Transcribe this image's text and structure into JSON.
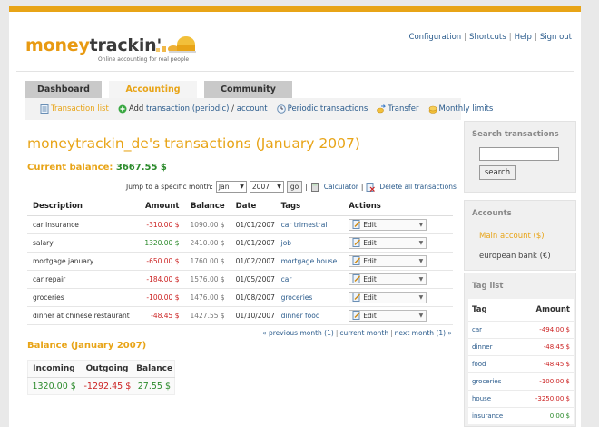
{
  "app": {
    "logo_part1": "money",
    "logo_part2": "trackin'",
    "tagline": "Online accounting for real people"
  },
  "toplinks": [
    "Configuration",
    "Shortcuts",
    "Help",
    "Sign out"
  ],
  "tabs": [
    {
      "label": "Dashboard",
      "active": false
    },
    {
      "label": "Accounting",
      "active": true
    },
    {
      "label": "Community",
      "active": false
    }
  ],
  "subnav": {
    "transaction_list": "Transaction list",
    "add": "Add",
    "add_transaction": "transaction",
    "add_periodic": "(periodic)",
    "add_slash": "/",
    "add_account": "account",
    "periodic": "Periodic transactions",
    "transfer": "Transfer",
    "monthly_limits": "Monthly limits"
  },
  "main": {
    "title": "moneytrackin_de's transactions  (January 2007)",
    "current_balance_label": "Current balance:",
    "current_balance_value": "3667.55 $",
    "jump_label": "Jump to a specific month:",
    "month_selected": "Jan",
    "year_selected": "2007",
    "go_label": "go",
    "calculator": "Calculator",
    "delete_all": "Delete all transactions"
  },
  "table": {
    "headers": [
      "Description",
      "Amount",
      "Balance",
      "Date",
      "Tags",
      "Actions"
    ],
    "rows": [
      {
        "description": "car insurance",
        "amount": "-310.00 $",
        "balance": "1090.00 $",
        "date": "01/01/2007",
        "tags": "car trimestral",
        "action": "Edit",
        "sign": "neg"
      },
      {
        "description": "salary",
        "amount": "1320.00 $",
        "balance": "2410.00 $",
        "date": "01/01/2007",
        "tags": "job",
        "action": "Edit",
        "sign": "pos"
      },
      {
        "description": "mortgage january",
        "amount": "-650.00 $",
        "balance": "1760.00 $",
        "date": "01/02/2007",
        "tags": "mortgage house",
        "action": "Edit",
        "sign": "neg"
      },
      {
        "description": "car repair",
        "amount": "-184.00 $",
        "balance": "1576.00 $",
        "date": "01/05/2007",
        "tags": "car",
        "action": "Edit",
        "sign": "neg"
      },
      {
        "description": "groceries",
        "amount": "-100.00 $",
        "balance": "1476.00 $",
        "date": "01/08/2007",
        "tags": "groceries",
        "action": "Edit",
        "sign": "neg"
      },
      {
        "description": "dinner at chinese restaurant",
        "amount": "-48.45 $",
        "balance": "1427.55 $",
        "date": "01/10/2007",
        "tags": "dinner food",
        "action": "Edit",
        "sign": "neg"
      }
    ]
  },
  "pager": {
    "prev": "« previous month (1)",
    "current": "current month",
    "next": "next month (1) »"
  },
  "summary": {
    "title": "Balance (January 2007)",
    "headers": [
      "Incoming",
      "Outgoing",
      "Balance"
    ],
    "incoming": "1320.00 $",
    "outgoing": "-1292.45 $",
    "balance": "27.55 $"
  },
  "sidebar": {
    "search_title": "Search transactions",
    "search_button": "search",
    "accounts_title": "Accounts",
    "accounts": [
      "Main account ($)",
      "european bank (€)"
    ],
    "taglist_title": "Tag list",
    "tag_headers": [
      "Tag",
      "Amount"
    ],
    "tags": [
      {
        "tag": "car",
        "amount": "-494.00 $",
        "sign": "neg"
      },
      {
        "tag": "dinner",
        "amount": "-48.45 $",
        "sign": "neg"
      },
      {
        "tag": "food",
        "amount": "-48.45 $",
        "sign": "neg"
      },
      {
        "tag": "groceries",
        "amount": "-100.00 $",
        "sign": "neg"
      },
      {
        "tag": "house",
        "amount": "-3250.00 $",
        "sign": "neg"
      },
      {
        "tag": "insurance",
        "amount": "0.00 $",
        "sign": "pos"
      }
    ]
  },
  "colors": {
    "accent": "#e8a417",
    "link": "#2a5b8c",
    "positive": "#2b8a2b",
    "negative": "#cc2222"
  }
}
